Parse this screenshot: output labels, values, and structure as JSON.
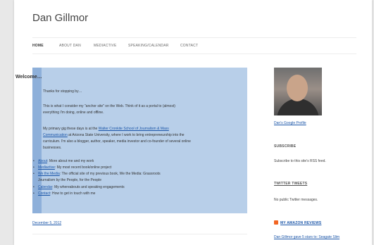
{
  "site": {
    "title": "Dan Gillmor"
  },
  "nav": {
    "items": [
      {
        "label": "HOME"
      },
      {
        "label": "ABOUT DAN"
      },
      {
        "label": "MEDIACTIVE"
      },
      {
        "label": "SPEAKING/CALENDAR"
      },
      {
        "label": "CONTACT"
      }
    ]
  },
  "welcome": {
    "heading": "Welcome…",
    "p1": "Thanks for stopping by…",
    "p2_line1": "This is what I consider my \"anchor site\" on the Web. Think of it as a portal to (almost)",
    "p2_line2": "everything I'm doing, online and offline.",
    "p3_line1_pre": "My primary gig these days is at the",
    "p3_link1": "Walter Cronkite School of Journalism & Mass",
    "p3_link2": "Communication",
    "p3_line2_post": " at Arizona State University, where I work to bring entrepreneurship into the",
    "p3_line3": "curriculum. I'm also a blogger, author, speaker, media investor and co-founder of several online",
    "p3_line4": "businesses.",
    "bullets": [
      {
        "link": "About",
        "text": ": More about me and my work"
      },
      {
        "link": "Mediactive",
        "text": ": My most recent book/online project"
      },
      {
        "link": "We the Media",
        "text": ": The official site of my previous book, We the Media: Grassroots"
      },
      {
        "link": "",
        "text": "Journalism by the People, for the People"
      },
      {
        "link": "Calendar",
        "text": ": My whereabouts and speaking engagements"
      },
      {
        "link": "Contact",
        "text": ": How to get in touch with me"
      }
    ]
  },
  "post": {
    "date": "December 5, 2012"
  },
  "sidebar": {
    "profile_link": "Dan's Google Profile",
    "subscribe_heading": "SUBSCRIBE",
    "subscribe_text": "Subscribe to this site's RSS feed.",
    "twitter_heading": "TWITTER TWEETS",
    "twitter_text": "No public Twitter messages.",
    "amazon_heading": "MY AMAZON REVIEWS",
    "amazon_item": "Dan Gillmor gave 5 stars to: Seagate Slim"
  },
  "colors": {
    "welcome_bg": "#b8cfe9",
    "welcome_accent": "#8eb0da",
    "link": "#1a55a8",
    "rss": "#f26522"
  }
}
